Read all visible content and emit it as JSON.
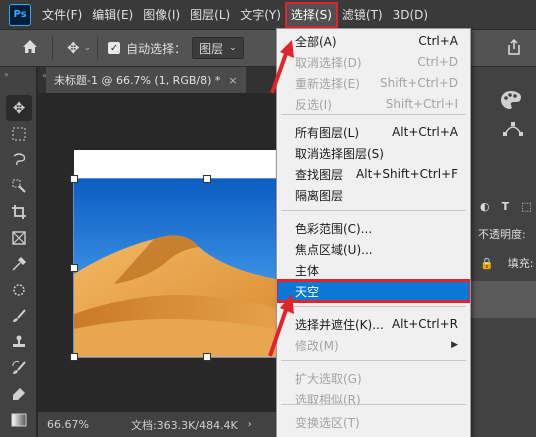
{
  "menubar": {
    "logo": "Ps",
    "items": [
      "文件(F)",
      "编辑(E)",
      "图像(I)",
      "图层(L)",
      "文字(Y)",
      "选择(S)",
      "滤镜(T)",
      "3D(D)"
    ],
    "active_index": 5
  },
  "options": {
    "auto_select_label": "自动选择：",
    "auto_select_value": "图层"
  },
  "document": {
    "tab_title": "未标题-1 @ 66.7% (1, RGB/8) *",
    "close": "×",
    "zoom": "66.67%",
    "doc_size": "文档:363.3K/484.4K"
  },
  "right_panel": {
    "opacity_label": "不透明度:",
    "fill_label": "填充:"
  },
  "select_menu": {
    "groups": [
      [
        {
          "label": "全部(A)",
          "shortcut": "Ctrl+A",
          "disabled": false
        },
        {
          "label": "取消选择(D)",
          "shortcut": "Ctrl+D",
          "disabled": true
        },
        {
          "label": "重新选择(E)",
          "shortcut": "Shift+Ctrl+D",
          "disabled": true
        },
        {
          "label": "反选(I)",
          "shortcut": "Shift+Ctrl+I",
          "disabled": true
        }
      ],
      [
        {
          "label": "所有图层(L)",
          "shortcut": "Alt+Ctrl+A",
          "disabled": false
        },
        {
          "label": "取消选择图层(S)",
          "shortcut": "",
          "disabled": false
        },
        {
          "label": "查找图层",
          "shortcut": "Alt+Shift+Ctrl+F",
          "disabled": false
        },
        {
          "label": "隔离图层",
          "shortcut": "",
          "disabled": false
        }
      ],
      [
        {
          "label": "色彩范围(C)...",
          "shortcut": "",
          "disabled": false
        },
        {
          "label": "焦点区域(U)...",
          "shortcut": "",
          "disabled": false
        },
        {
          "label": "主体",
          "shortcut": "",
          "disabled": false
        },
        {
          "label": "天空",
          "shortcut": "",
          "disabled": false,
          "highlight": true
        }
      ],
      [
        {
          "label": "选择并遮住(K)...",
          "shortcut": "Alt+Ctrl+R",
          "disabled": false
        },
        {
          "label": "修改(M)",
          "shortcut": "",
          "disabled": true,
          "submenu": true
        }
      ],
      [
        {
          "label": "扩大选取(G)",
          "shortcut": "",
          "disabled": true
        },
        {
          "label": "选取相似(R)",
          "shortcut": "",
          "disabled": true
        }
      ],
      [
        {
          "label": "变换选区(T)",
          "shortcut": "",
          "disabled": true
        }
      ]
    ]
  },
  "colors": {
    "accent_red": "#e2232a",
    "menu_highlight": "#0b78d6",
    "ps_blue": "#31a8ff"
  }
}
